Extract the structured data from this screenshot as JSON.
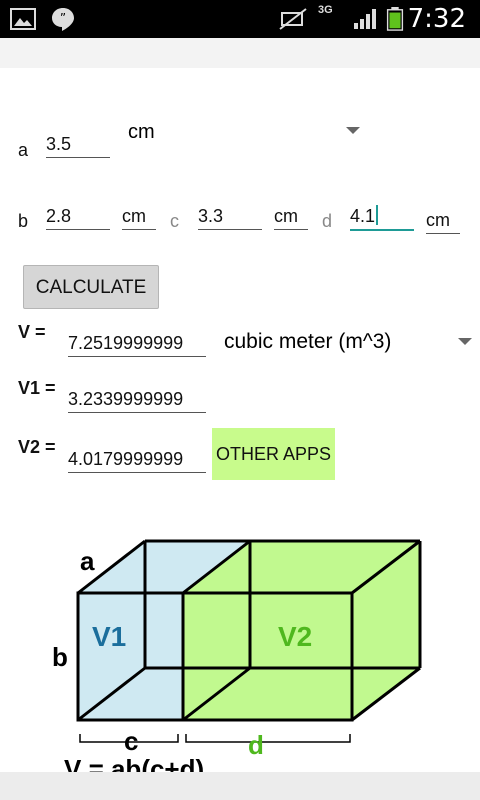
{
  "status_bar": {
    "time": "7:32",
    "network": "3G",
    "icons": [
      "image-icon",
      "hangouts-icon",
      "mute-icon",
      "network-3g-icon",
      "signal-icon",
      "battery-icon"
    ]
  },
  "inputs": {
    "a": {
      "label": "a",
      "value": "3.5",
      "unit": "cm"
    },
    "b": {
      "label": "b",
      "value": "2.8",
      "unit": "cm"
    },
    "c": {
      "label": "c",
      "value": "3.3",
      "unit": "cm"
    },
    "d": {
      "label": "d",
      "value": "4.1",
      "unit": "cm"
    }
  },
  "calculate_label": "CALCULATE",
  "results": {
    "v": {
      "label": "V =",
      "value": "7.2519999999",
      "unit": "cubic meter (m^3)"
    },
    "v1": {
      "label": "V1 =",
      "value": "3.2339999999"
    },
    "v2": {
      "label": "V2 =",
      "value": "4.0179999999"
    }
  },
  "other_apps_label": "OTHER APPS",
  "diagram": {
    "label_a": "a",
    "label_b": "b",
    "label_c": "c",
    "label_d": "d",
    "label_v1": "V1",
    "label_v2": "V2",
    "formula": "V = ab(c+d)",
    "colors": {
      "v1_fill": "#cfe9f2",
      "v2_fill": "#c1f98f",
      "v1_text": "#1b6e9c",
      "v2_text": "#4fb81e",
      "d_text": "#4fb81e"
    }
  }
}
